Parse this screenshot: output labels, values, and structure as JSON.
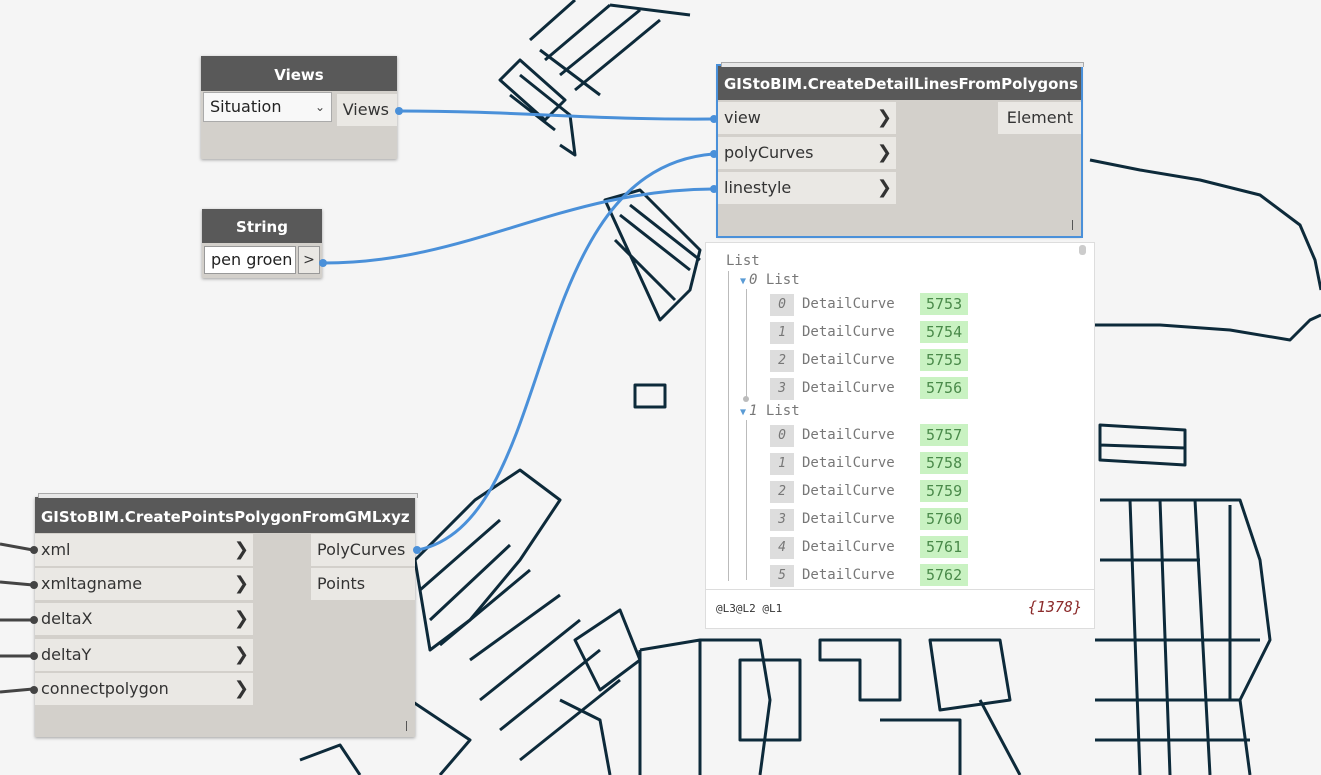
{
  "nodes": {
    "views": {
      "title": "Views",
      "dropdown_value": "Situation",
      "output": "Views"
    },
    "string": {
      "title": "String",
      "value": "pen groen",
      "button": ">"
    },
    "create_detail_lines": {
      "title": "GIStoBIM.CreateDetailLinesFromPolygons",
      "inputs": [
        "view",
        "polyCurves",
        "linestyle"
      ],
      "output": "Element"
    },
    "create_points_polygon": {
      "title": "GIStoBIM.CreatePointsPolygonFromGMLxyz",
      "inputs": [
        "xml",
        "xmltagname",
        "deltaX",
        "deltaY",
        "connectpolygon"
      ],
      "outputs": [
        "PolyCurves",
        "Points"
      ]
    }
  },
  "preview": {
    "root_label": "List",
    "groups": [
      {
        "index": "0",
        "label": "List",
        "items": [
          {
            "index": "0",
            "type": "DetailCurve",
            "id": "5753"
          },
          {
            "index": "1",
            "type": "DetailCurve",
            "id": "5754"
          },
          {
            "index": "2",
            "type": "DetailCurve",
            "id": "5755"
          },
          {
            "index": "3",
            "type": "DetailCurve",
            "id": "5756"
          }
        ]
      },
      {
        "index": "1",
        "label": "List",
        "items": [
          {
            "index": "0",
            "type": "DetailCurve",
            "id": "5757"
          },
          {
            "index": "1",
            "type": "DetailCurve",
            "id": "5758"
          },
          {
            "index": "2",
            "type": "DetailCurve",
            "id": "5759"
          },
          {
            "index": "3",
            "type": "DetailCurve",
            "id": "5760"
          },
          {
            "index": "4",
            "type": "DetailCurve",
            "id": "5761"
          },
          {
            "index": "5",
            "type": "DetailCurve",
            "id": "5762"
          }
        ]
      }
    ],
    "levels": "@L3@L2 @L1",
    "count": "{1378}"
  },
  "colors": {
    "wire": "#4a90d9",
    "header": "#595959",
    "node_body": "#d3d0cb",
    "value_bg": "#c9f2c2"
  }
}
